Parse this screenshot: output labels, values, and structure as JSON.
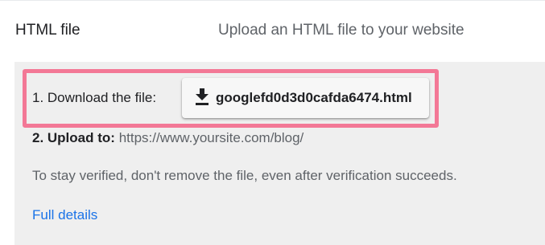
{
  "method": {
    "name": "HTML file",
    "description": "Upload an HTML file to your website"
  },
  "steps": {
    "download": {
      "label": "1. Download the file:",
      "button_label": "googlefd0d3d0cafda6474.html",
      "icon": "download-icon"
    },
    "upload": {
      "label": "2. Upload to:",
      "url": "https://www.yoursite.com/blog/"
    }
  },
  "note": "To stay verified, don't remove the file, even after verification succeeds.",
  "details_link": "Full details",
  "colors": {
    "highlight_border": "#f37896",
    "link": "#1a73e8",
    "panel_background": "#efefef"
  }
}
